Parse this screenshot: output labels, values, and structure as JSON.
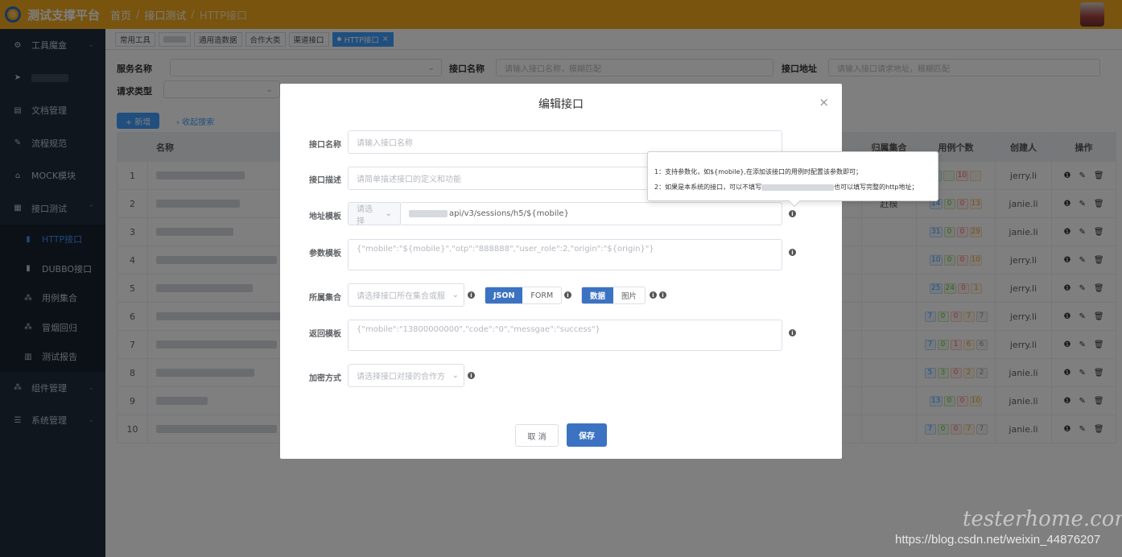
{
  "app": {
    "title": "测试支撑平台",
    "logo_glyph": "◎"
  },
  "breadcrumb": {
    "home": "首页",
    "section": "接口测试",
    "current": "HTTP接口"
  },
  "sidebar": {
    "items": [
      {
        "label": "工具魔盒",
        "icon": "⚙"
      },
      {
        "label": "",
        "icon": "➤"
      },
      {
        "label": "文档管理",
        "icon": "▤"
      },
      {
        "label": "流程规范",
        "icon": "✎"
      },
      {
        "label": "MOCK模块",
        "icon": "⌂"
      },
      {
        "label": "接口测试",
        "icon": "▦"
      }
    ],
    "sub_items": [
      {
        "label": "HTTP接口",
        "icon": "▮"
      },
      {
        "label": "DUBBO接口",
        "icon": "▮"
      },
      {
        "label": "用例集合",
        "icon": "⁂"
      },
      {
        "label": "冒烟回归",
        "icon": "⁂"
      },
      {
        "label": "测试报告",
        "icon": "▥"
      }
    ],
    "bottom_items": [
      {
        "label": "组件管理",
        "icon": "⁂"
      },
      {
        "label": "系统管理",
        "icon": "☰"
      }
    ]
  },
  "tabs": [
    "常用工具",
    "",
    "通用造数据",
    "合作大类",
    "渠道接口",
    "HTTP接口"
  ],
  "tab_close": "×",
  "filters": {
    "service_label": "服务名称",
    "api_name_label": "接口名称",
    "api_name_placeholder": "请输入接口名称，模糊匹配",
    "api_addr_label": "接口地址",
    "api_addr_placeholder": "请输入接口请求地址，模糊匹配",
    "req_type_label": "请求类型"
  },
  "actions": {
    "new": "+ 新增",
    "collapse": "› 收起搜索"
  },
  "table": {
    "headers": {
      "name": "名称",
      "collection": "归属集合",
      "cases": "用例个数",
      "creator": "创建人",
      "ops": "操作"
    },
    "rows": [
      {
        "no": "1",
        "collection": "",
        "creator": "jerry.li",
        "badges": [
          "",
          "",
          "10",
          ""
        ]
      },
      {
        "no": "2",
        "collection": "赶模",
        "creator": "janie.li",
        "badges": [
          "14",
          "0",
          "0",
          "13"
        ]
      },
      {
        "no": "3",
        "collection": "",
        "creator": "janie.li",
        "badges": [
          "31",
          "0",
          "0",
          "29"
        ]
      },
      {
        "no": "4",
        "collection": "",
        "creator": "jerry.li",
        "badges": [
          "10",
          "0",
          "0",
          "10"
        ]
      },
      {
        "no": "5",
        "collection": "",
        "creator": "jerry.li",
        "badges": [
          "25",
          "24",
          "0",
          "1"
        ]
      },
      {
        "no": "6",
        "collection": "",
        "creator": "jerry.li",
        "badges": [
          "7",
          "0",
          "0",
          "7",
          "7"
        ]
      },
      {
        "no": "7",
        "collection": "",
        "creator": "jerry.li",
        "badges": [
          "7",
          "0",
          "1",
          "6",
          "6"
        ]
      },
      {
        "no": "8",
        "collection": "",
        "creator": "janie.li",
        "badges": [
          "5",
          "3",
          "0",
          "2",
          "2"
        ]
      },
      {
        "no": "9",
        "collection": "",
        "creator": "janie.li",
        "badges": [
          "13",
          "0",
          "0",
          "10"
        ]
      },
      {
        "no": "10",
        "collection": "",
        "creator": "janie.li",
        "badges": [
          "7",
          "0",
          "0",
          "7",
          "7"
        ]
      }
    ],
    "op_icons": [
      "❶",
      "✎",
      "🗑"
    ]
  },
  "modal": {
    "title": "编辑接口",
    "close": "×",
    "name_label": "接口名称",
    "name_placeholder": "请输入接口名称",
    "desc_label": "接口描述",
    "desc_placeholder": "请简单描述接口的定义和功能",
    "addr_label": "地址模板",
    "addr_select": "请选择",
    "addr_value": "api/v3/sessions/h5/${mobile}",
    "param_label": "参数模板",
    "param_value": "{\"mobile\":\"${mobile}\",\"otp\":\"888888\",\"user_role\":2,\"origin\":\"${origin}\"}",
    "collection_label": "所属集合",
    "collection_placeholder": "请选择接口所在集合或服",
    "fmt_json": "JSON",
    "fmt_form": "FORM",
    "data_opt": "数据",
    "img_opt": "图片",
    "return_label": "返回模板",
    "return_value": "{\"mobile\":\"13800000000\",\"code\":\"0\",\"messgae\":\"success\"}",
    "encrypt_label": "加密方式",
    "encrypt_placeholder": "请选择接口对接的合作方",
    "cancel": "取 消",
    "save": "保存"
  },
  "tooltip": {
    "line1": "1：支持参数化，如${mobile},在添加该接口的用例时配置该参数即可；",
    "line2a": "2：如果是本系统的接口，可以不填写",
    "line2b": "也可以填写完整的http地址；"
  },
  "watermark": {
    "url": "https://blog.csdn.net/weixin_44876207",
    "brand": "testerhome.com"
  }
}
